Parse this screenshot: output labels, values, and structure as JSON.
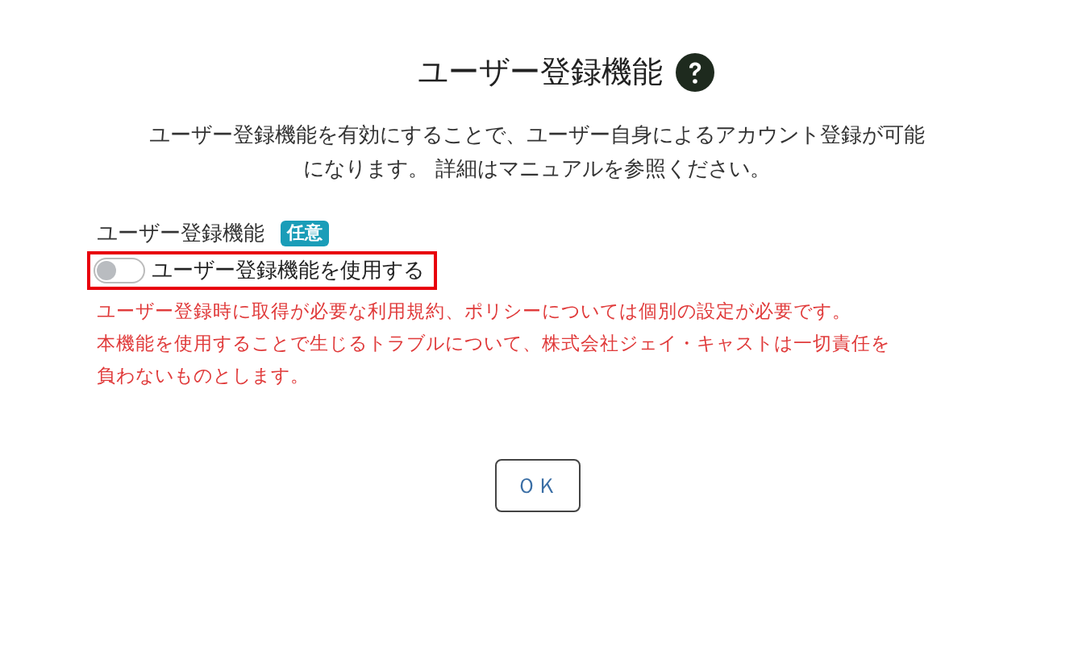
{
  "title": "ユーザー登録機能",
  "description": [
    "ユーザー登録機能を有効にすることで、ユーザー自身によるアカウント登録が可能",
    "になります。 詳細はマニュアルを参照ください。"
  ],
  "field": {
    "label": "ユーザー登録機能",
    "badge": "任意",
    "toggle": {
      "label": "ユーザー登録機能を使用する",
      "on": false,
      "highlighted": true
    }
  },
  "notes": [
    "ユーザー登録時に取得が必要な利用規約、ポリシーについては個別の設定が必要です。",
    "本機能を使用することで生じるトラブルについて、株式会社ジェイ・キャストは一切責任を",
    "負わないものとします。"
  ],
  "buttons": [
    "ＯＫ"
  ]
}
